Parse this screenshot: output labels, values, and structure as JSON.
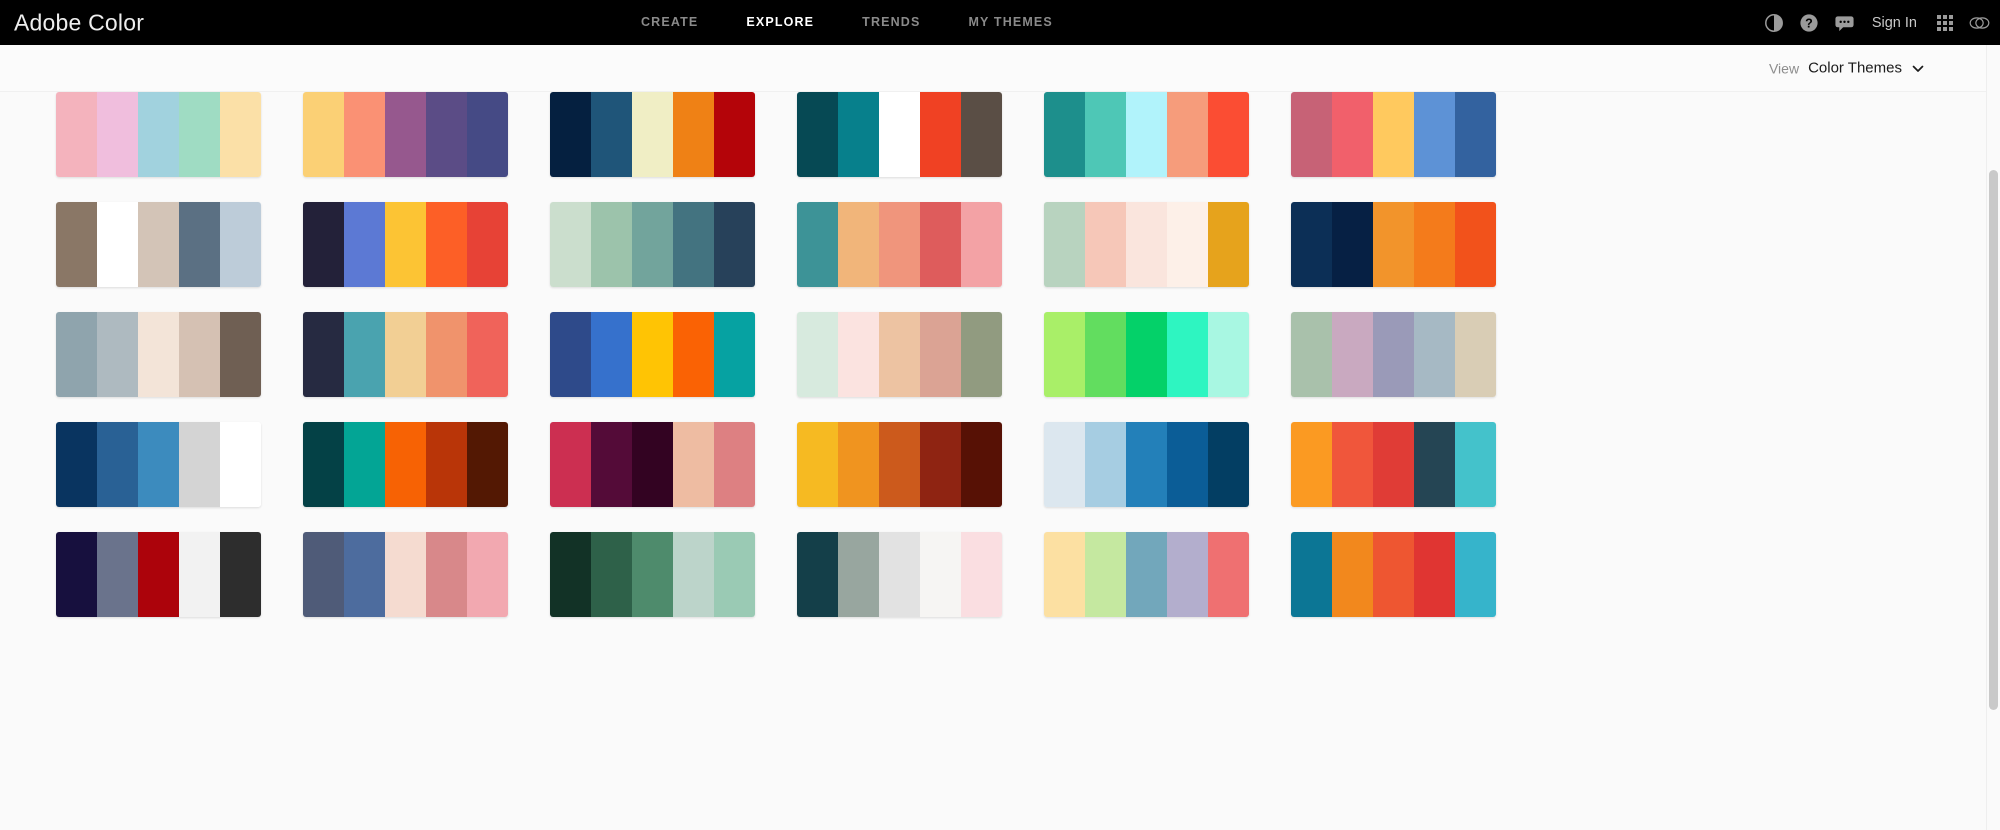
{
  "header": {
    "brand": "Adobe Color",
    "nav": [
      {
        "label": "CREATE",
        "active": false
      },
      {
        "label": "EXPLORE",
        "active": true
      },
      {
        "label": "TRENDS",
        "active": false
      },
      {
        "label": "MY THEMES",
        "active": false
      }
    ],
    "sign_in": "Sign In",
    "icons": [
      "contrast-icon",
      "help-icon",
      "feedback-icon",
      "app-grid-icon",
      "creative-cloud-icon"
    ]
  },
  "viewbar": {
    "label": "View",
    "value": "Color Themes",
    "chevron": "chevron-down-icon"
  },
  "grid": {
    "columns": 6,
    "rows": 5,
    "themes": [
      {
        "swatches": [
          "#f4b3bd",
          "#f0bedd",
          "#a1d2de",
          "#9fdcc3",
          "#fbe0a7"
        ]
      },
      {
        "swatches": [
          "#fbd075",
          "#fa9174",
          "#96588e",
          "#5b4c86",
          "#454a85"
        ]
      },
      {
        "swatches": [
          "#052040",
          "#1f5579",
          "#f0eec5",
          "#ef8115",
          "#b40409"
        ]
      },
      {
        "swatches": [
          "#064954",
          "#07808c",
          "#ffffff",
          "#f04123",
          "#5a4e45"
        ]
      },
      {
        "swatches": [
          "#1d8f8c",
          "#4ec7b6",
          "#b1f3fb",
          "#f69c7b",
          "#fb4d33"
        ]
      },
      {
        "swatches": [
          "#c76276",
          "#f1606b",
          "#ffc95e",
          "#5d92d6",
          "#33629f"
        ]
      },
      {
        "swatches": [
          "#8a7766",
          "#ffffff",
          "#d3c4b7",
          "#5b7083",
          "#bdccd9"
        ]
      },
      {
        "swatches": [
          "#232139",
          "#5c79d4",
          "#fcc434",
          "#fd5f26",
          "#e74236"
        ]
      },
      {
        "swatches": [
          "#cbdecd",
          "#9cc3ab",
          "#72a49c",
          "#437380",
          "#27415a"
        ]
      },
      {
        "swatches": [
          "#3d9397",
          "#f1b57a",
          "#f0957c",
          "#de5c5c",
          "#f3a2a5"
        ]
      },
      {
        "swatches": [
          "#b8d3bf",
          "#f6c7b8",
          "#fae5dd",
          "#fdf0e8",
          "#e6a31c"
        ]
      },
      {
        "swatches": [
          "#0c2f56",
          "#062044",
          "#f2942b",
          "#f47b1b",
          "#f2521b"
        ]
      },
      {
        "swatches": [
          "#8fa4ad",
          "#aebac0",
          "#f3e4d8",
          "#d5c1b3",
          "#6f5f53"
        ]
      },
      {
        "swatches": [
          "#262a41",
          "#4aa3af",
          "#f2cf94",
          "#f0936c",
          "#f0635a"
        ]
      },
      {
        "swatches": [
          "#2e4a8a",
          "#3671cc",
          "#ffc404",
          "#fa6204",
          "#06a2a2"
        ]
      },
      {
        "swatches": [
          "#d7eade",
          "#fbe3e0",
          "#edc3a2",
          "#dba394",
          "#919b80"
        ]
      },
      {
        "swatches": [
          "#a9ef68",
          "#62dd5f",
          "#04d169",
          "#2ef5c1",
          "#a8f7e2"
        ]
      },
      {
        "swatches": [
          "#a9c1ab",
          "#c9a9c0",
          "#9a9ab8",
          "#a6b9c4",
          "#d9cdb5"
        ]
      },
      {
        "swatches": [
          "#093460",
          "#296195",
          "#3c8bbe",
          "#d4d4d4",
          "#ffffff"
        ]
      },
      {
        "swatches": [
          "#044146",
          "#03a595",
          "#f76204",
          "#b93508",
          "#531803"
        ]
      },
      {
        "swatches": [
          "#cc2f51",
          "#540b38",
          "#330322",
          "#eebca2",
          "#dd8082"
        ]
      },
      {
        "swatches": [
          "#f6ba22",
          "#f0941f",
          "#cc5a1c",
          "#8f2412",
          "#571105"
        ]
      },
      {
        "swatches": [
          "#dce7ef",
          "#a6cde2",
          "#2380b9",
          "#0b5d97",
          "#033e63"
        ]
      },
      {
        "swatches": [
          "#fb9a22",
          "#f0563b",
          "#e03c36",
          "#254554",
          "#44c2cb"
        ]
      },
      {
        "swatches": [
          "#17103e",
          "#6a738c",
          "#ac030b",
          "#f2f2f2",
          "#2d2d2d"
        ]
      },
      {
        "swatches": [
          "#4f5b78",
          "#4d6c9e",
          "#f5dbd0",
          "#d8888a",
          "#f2a8b0"
        ]
      },
      {
        "swatches": [
          "#123226",
          "#2e6149",
          "#4e8b6c",
          "#bcd4ca",
          "#9acab4"
        ]
      },
      {
        "swatches": [
          "#143f49",
          "#98a69f",
          "#e2e2e2",
          "#f6f5f3",
          "#fadee1"
        ]
      },
      {
        "swatches": [
          "#fce0a2",
          "#c5e8a0",
          "#72a7bb",
          "#b3aecd",
          "#ef7071"
        ]
      },
      {
        "swatches": [
          "#0c7695",
          "#f2881d",
          "#ee5631",
          "#e03532",
          "#36b4cb"
        ]
      }
    ]
  },
  "scrollbar": {
    "name": "vertical-scrollbar"
  }
}
